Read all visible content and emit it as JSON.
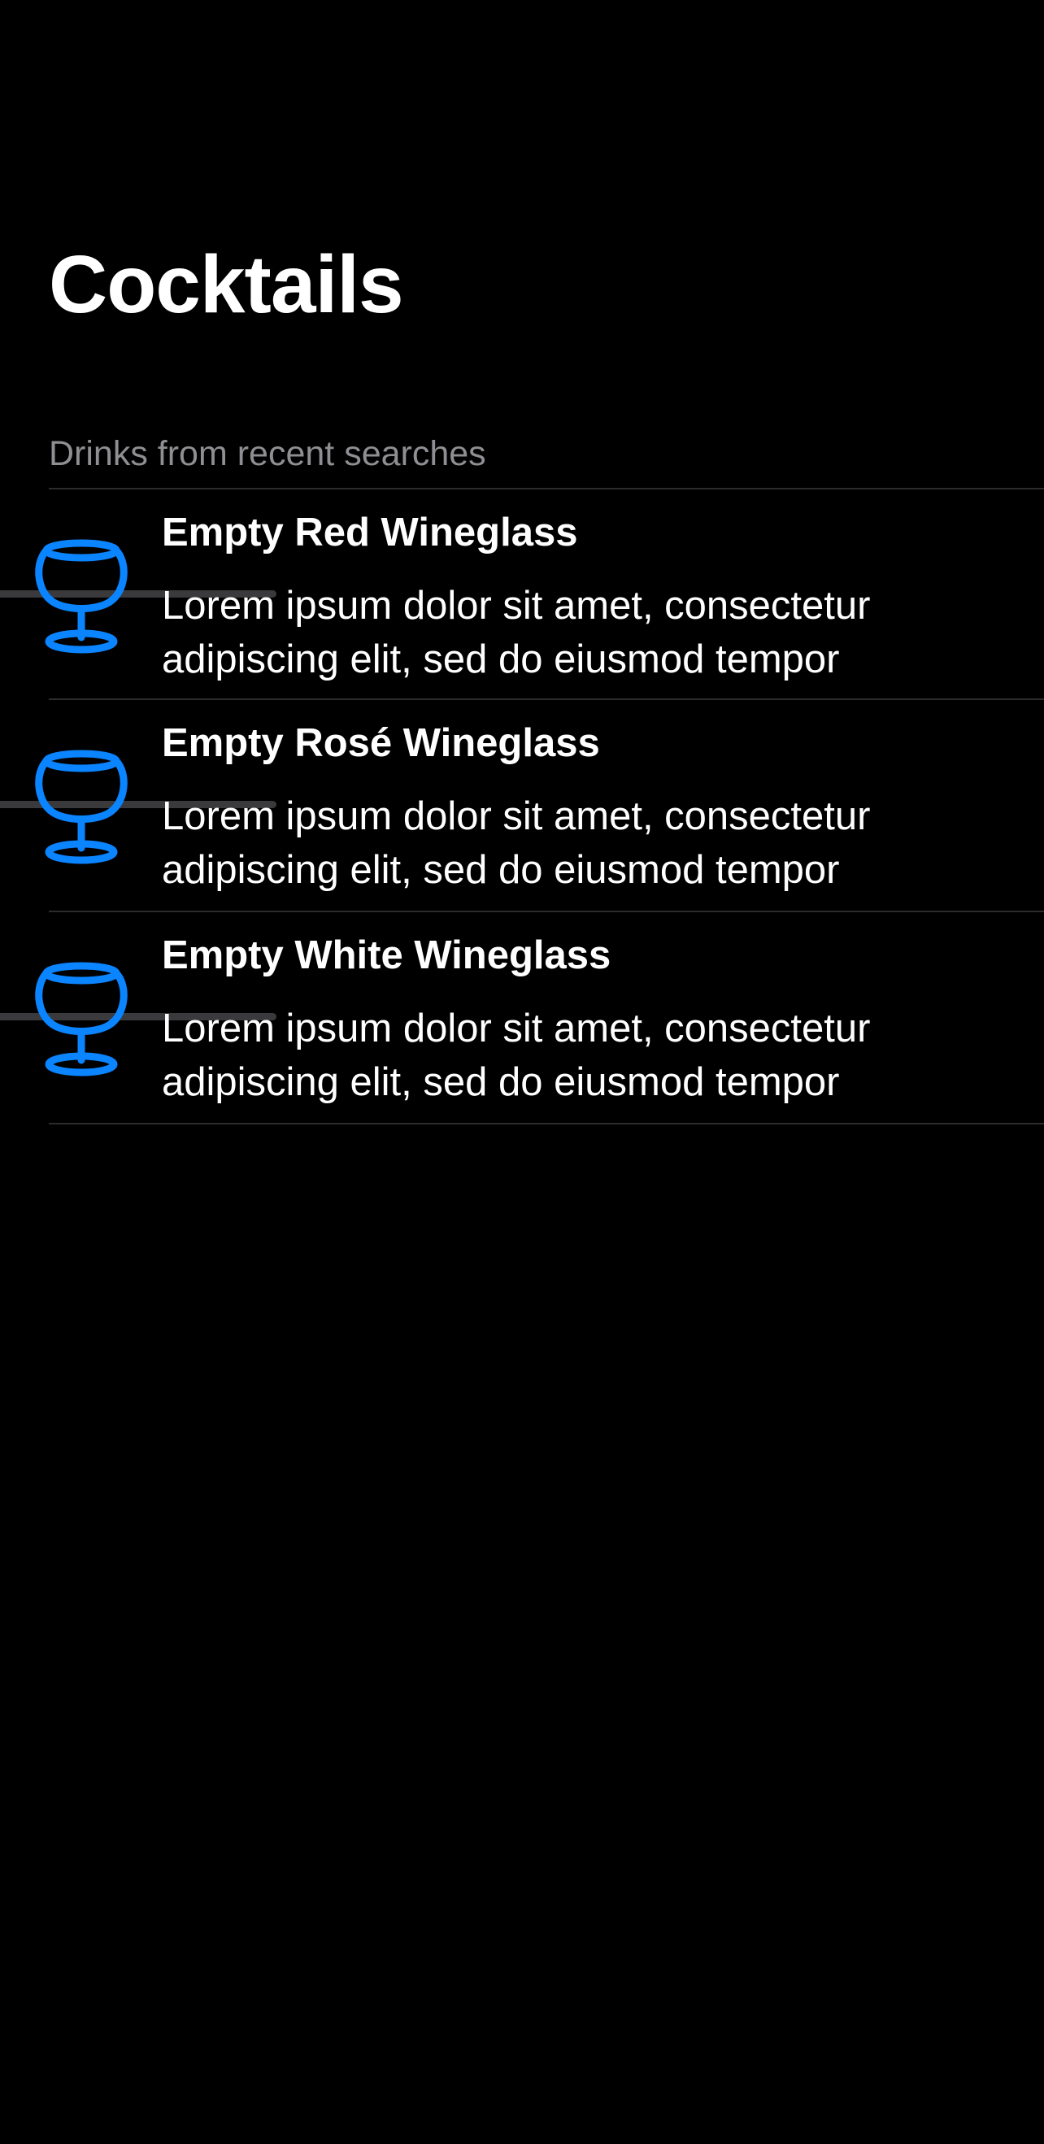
{
  "screen": {
    "title": "Cocktails",
    "section_header": "Drinks from recent searches"
  },
  "colors": {
    "background": "#000000",
    "accent": "#0a84ff",
    "secondary_text": "#8e8e93",
    "separator": "#2c2c2e"
  },
  "drinks": [
    {
      "title": "Empty Red Wineglass",
      "description": "Lorem ipsum dolor sit amet, consectetur adipiscing elit, sed do eiusmod tempor",
      "icon": "wineglass-icon"
    },
    {
      "title": "Empty Rosé Wineglass",
      "description": "Lorem ipsum dolor sit amet, consectetur adipiscing elit, sed do eiusmod tempor",
      "icon": "wineglass-icon"
    },
    {
      "title": "Empty White Wineglass",
      "description": "Lorem ipsum dolor sit amet, consectetur adipiscing elit, sed do eiusmod tempor",
      "icon": "wineglass-icon"
    }
  ]
}
